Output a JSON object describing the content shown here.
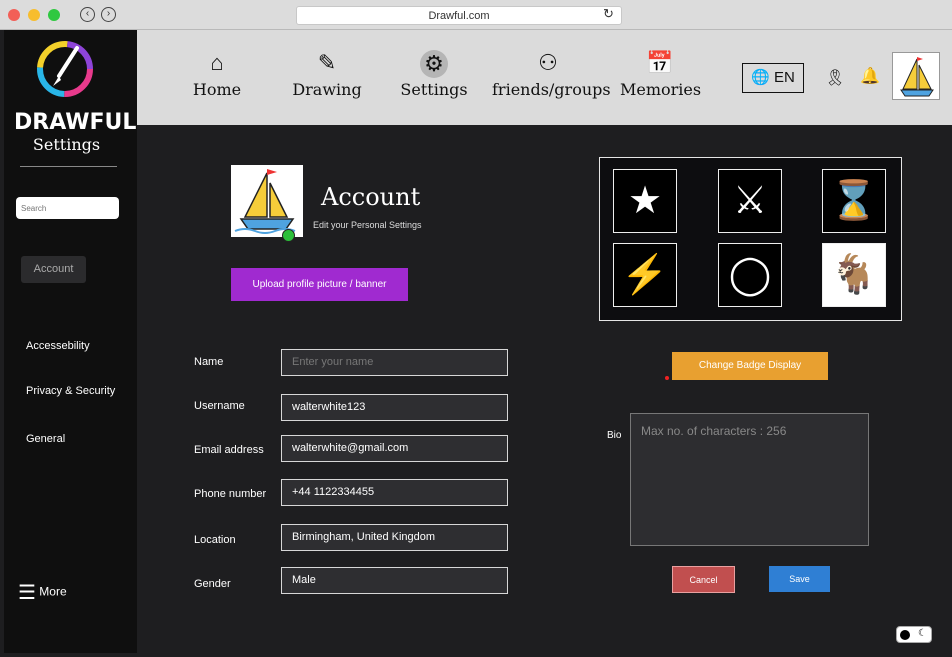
{
  "browser": {
    "url": "Drawful.com"
  },
  "sidebar": {
    "brand": "DRAWFUL",
    "title": "Settings",
    "search_placeholder": "Search",
    "items": [
      {
        "label": "Account"
      },
      {
        "label": "Accessebility"
      },
      {
        "label": "Privacy & Security"
      },
      {
        "label": "General"
      }
    ],
    "more_label": "More"
  },
  "topnav": {
    "tabs": [
      {
        "label": "Home",
        "icon": "home-icon"
      },
      {
        "label": "Drawing",
        "icon": "pen-icon"
      },
      {
        "label": "Settings",
        "icon": "gear-icon"
      },
      {
        "label": "friends/groups",
        "icon": "users-icon"
      },
      {
        "label": "Memories",
        "icon": "calendar-icon"
      }
    ],
    "language": "EN"
  },
  "account": {
    "title": "Account",
    "subtitle": "Edit your Personal Settings",
    "upload_label": "Upload  profile picture / banner"
  },
  "form": {
    "name_label": "Name",
    "name_placeholder": "Enter your name",
    "username_label": "Username",
    "username_value": "walterwhite123",
    "email_label": "Email address",
    "email_value": "walterwhite@gmail.com",
    "phone_label": "Phone number",
    "phone_value": "+44 1122334455",
    "location_label": "Location",
    "location_value": "Birmingham, United Kingdom",
    "gender_label": "Gender",
    "gender_value": "Male"
  },
  "badges": {
    "items": [
      "star-icon",
      "spartan-helmet-icon",
      "hourglass-icon",
      "lightning-icon",
      "astronaut-helmet-icon",
      "goat-icon"
    ],
    "change_label": "Change Badge Display"
  },
  "bio": {
    "label": "Bio",
    "placeholder": "Max no. of characters : 256"
  },
  "actions": {
    "cancel_label": "Cancel",
    "save_label": "Save"
  },
  "colors": {
    "upload": "#a02ad0",
    "change_badge": "#e8a030",
    "cancel": "#c14f4f",
    "save": "#2f7fd4",
    "status_online": "#2bbf3a"
  }
}
